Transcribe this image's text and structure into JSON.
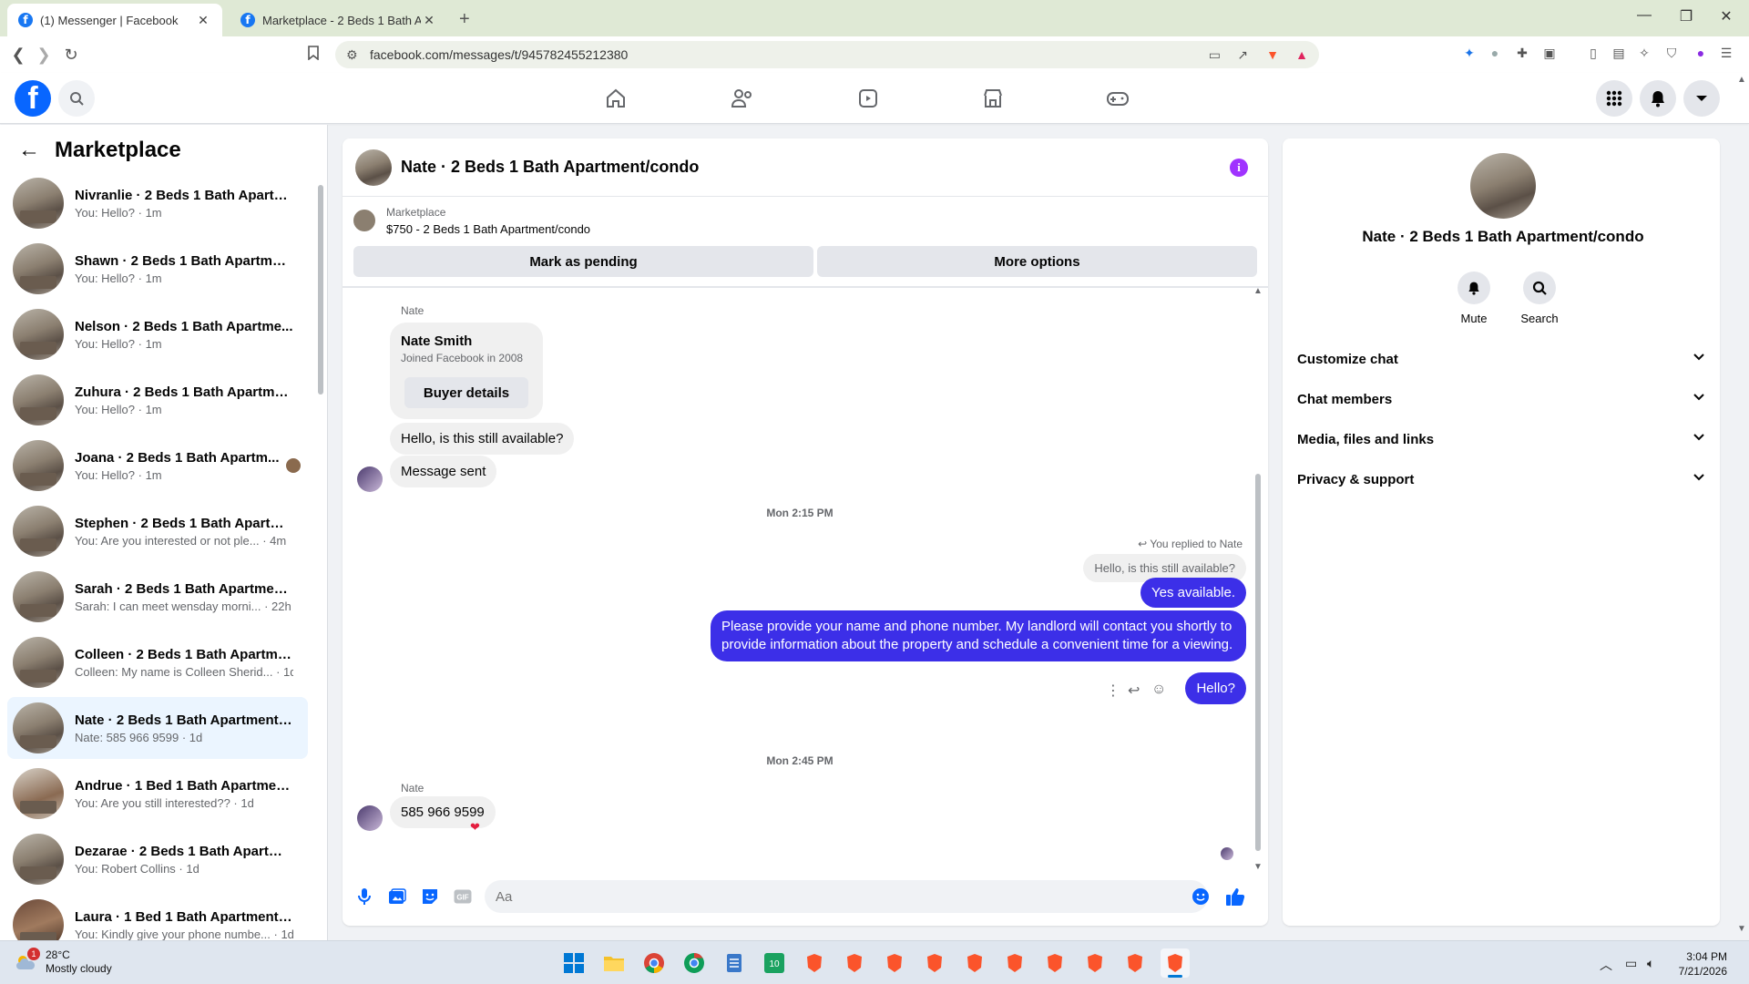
{
  "browser": {
    "tabs": [
      {
        "title": "(1) Messenger | Facebook",
        "active": true
      },
      {
        "title": "Marketplace - 2 Beds 1 Bath Apartme",
        "active": false
      }
    ],
    "url": "facebook.com/messages/t/945782455212380"
  },
  "colors": {
    "brand": "#0866ff",
    "outgoing_bubble": "#3c2fe8",
    "info": "#a033ff",
    "active_conv": "#ebf5ff"
  },
  "sidebar": {
    "title": "Marketplace",
    "conversations": [
      {
        "name": "Nivranlie · 2 Beds 1 Bath Apartm...",
        "preview": "You: Hello? · 1m"
      },
      {
        "name": "Shawn · 2 Beds 1 Bath Apartmen...",
        "preview": "You: Hello? · 1m"
      },
      {
        "name": "Nelson · 2 Beds 1 Bath Apartme...",
        "preview": "You: Hello? · 1m"
      },
      {
        "name": "Zuhura · 2 Beds 1 Bath Apartme...",
        "preview": "You: Hello? · 1m"
      },
      {
        "name": "Joana · 2 Beds 1 Bath Apartm...",
        "preview": "You: Hello? · 1m"
      },
      {
        "name": "Stephen · 2 Beds 1 Bath Apartm...",
        "preview": "You: Are you interested or not ple... · 4m"
      },
      {
        "name": "Sarah · 2 Beds 1 Bath Apartment...",
        "preview": "Sarah: I can meet wensday morni... · 22h"
      },
      {
        "name": "Colleen · 2 Beds 1 Bath Apartme...",
        "preview": "Colleen: My name is Colleen Sherid... · 1d"
      },
      {
        "name": "Nate · 2 Beds 1 Bath Apartment/...",
        "preview": "Nate: 585 966 9599 · 1d"
      },
      {
        "name": "Andrue · 1 Bed 1 Bath Apartmen...",
        "preview": "You: Are you still interested?? · 1d"
      },
      {
        "name": "Dezarae · 2 Beds 1 Bath Apartme...",
        "preview": "You: Robert Collins · 1d"
      },
      {
        "name": "Laura · 1 Bed 1 Bath Apartment/...",
        "preview": "You: Kindly give your phone numbe... · 1d"
      }
    ]
  },
  "chat": {
    "title": "Nate · 2 Beds 1 Bath Apartment/condo",
    "listing_label": "Marketplace",
    "listing_price": "$750 - 2 Beds 1 Bath Apartment/condo",
    "mark_pending": "Mark as pending",
    "more_options": "More options",
    "sender_name": "Nate",
    "card_name": "Nate Smith",
    "card_joined": "Joined Facebook in 2008",
    "card_button": "Buyer details",
    "msg1": "Hello, is this still available?",
    "msg2": "Message sent",
    "ts1": "Mon 2:15 PM",
    "replied": "You replied to Nate",
    "quote": "Hello, is this still available?",
    "out1": "Yes available.",
    "out2": "Please provide your name and phone number. My landlord will contact you shortly to provide information about the property and schedule a convenient time for a viewing.",
    "out3": "Hello?",
    "ts2": "Mon 2:45 PM",
    "sender_name2": "Nate",
    "msg3": "585 966 9599",
    "reaction": "❤",
    "composer_placeholder": "Aa"
  },
  "info_panel": {
    "name": "Nate · 2 Beds 1 Bath Apartment/condo",
    "mute": "Mute",
    "search": "Search",
    "sections": [
      "Customize chat",
      "Chat members",
      "Media, files and links",
      "Privacy & support"
    ]
  },
  "taskbar": {
    "temp": "28°C",
    "weather": "Mostly cloudy",
    "weather_badge": "1",
    "time": "3:04 PM",
    "date": "7/21/2026"
  }
}
